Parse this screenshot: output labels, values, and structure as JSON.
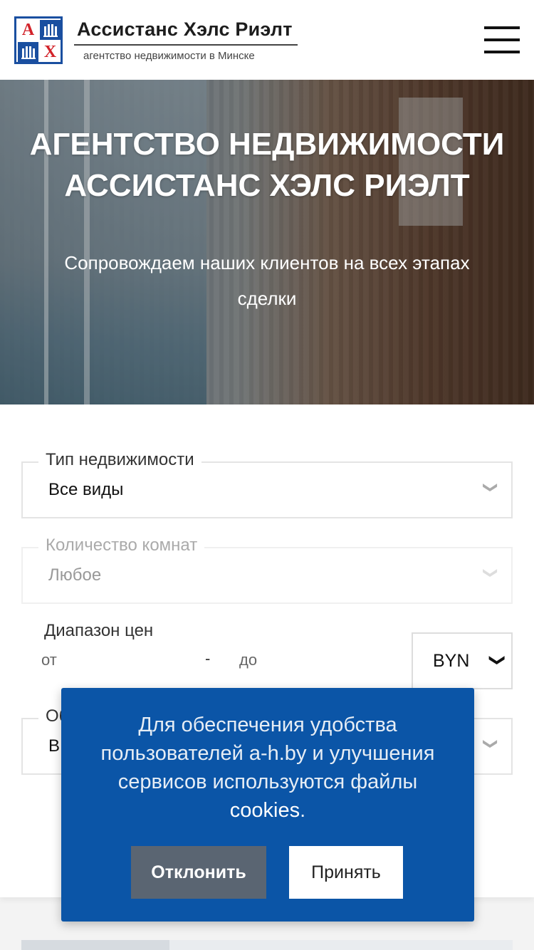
{
  "header": {
    "logo_letters": [
      "A",
      "",
      "",
      "X"
    ],
    "brand": "Ассистанс Хэлс Риэлт",
    "tagline": "агентство недвижимости в Минске",
    "menu_icon": "hamburger-menu-icon"
  },
  "hero": {
    "title": "АГЕНТСТВО НЕДВИЖИМОСТИ АССИСТАНС ХЭЛС РИЭЛТ",
    "subtitle": "Сопровождаем наших клиентов на всех этапах сделки"
  },
  "form": {
    "property_type": {
      "label": "Тип недвижимости",
      "value": "Все виды"
    },
    "rooms": {
      "label": "Количество комнат",
      "value": "Любое"
    },
    "price": {
      "label": "Диапазон цен",
      "from": "от",
      "dash": "-",
      "to": "до",
      "currency": "BYN"
    },
    "object": {
      "label_fragment": "Об",
      "value_fragment": "В"
    }
  },
  "cookie": {
    "message_start": "Для обеспечения удобства пользователей a-h.by и улучшения сервисов используются файлы ",
    "link": "cookies",
    "message_end": ".",
    "decline": "Отклонить",
    "accept": "Принять"
  },
  "colors": {
    "brand_blue": "#1a4fa0",
    "brand_red": "#d2232a",
    "cookie_bg": "#0b55a7",
    "decline_bg": "#5a6572"
  }
}
